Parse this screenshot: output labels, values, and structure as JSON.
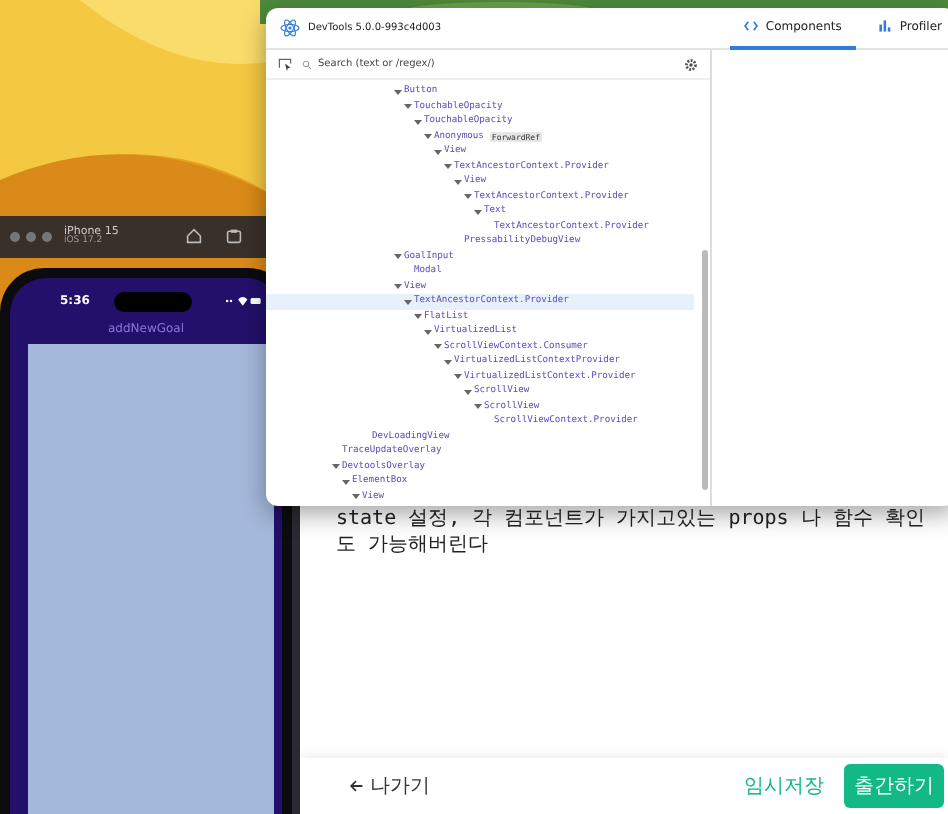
{
  "simulator": {
    "device": "iPhone 15",
    "os": "iOS 17.2",
    "time": "5:36",
    "screen_title": "addNewGoal"
  },
  "devtools": {
    "title": "DevTools 5.0.0-993c4d003",
    "tabs": [
      {
        "label": "Components",
        "selected": true
      },
      {
        "label": "Profiler",
        "selected": false
      }
    ],
    "search": {
      "placeholder": "Search (text or /regex/)"
    },
    "tree": {
      "groups": [
        [
          {
            "name": "Button",
            "expanded": true,
            "selected": false,
            "children": [
              {
                "name": "TouchableOpacity",
                "expanded": true,
                "selected": false,
                "children": [
                  {
                    "name": "TouchableOpacity",
                    "expanded": true,
                    "selected": false,
                    "children": [
                      {
                        "name": "Anonymous",
                        "badge": "ForwardRef",
                        "expanded": true,
                        "selected": false,
                        "children": [
                          {
                            "name": "View",
                            "expanded": true,
                            "selected": false,
                            "children": [
                              {
                                "name": "TextAncestorContext.Provider",
                                "expanded": true,
                                "selected": false,
                                "children": [
                                  {
                                    "name": "View",
                                    "expanded": true,
                                    "selected": false,
                                    "children": [
                                      {
                                        "name": "TextAncestorContext.Provider",
                                        "expanded": true,
                                        "selected": false,
                                        "children": [
                                          {
                                            "name": "Text",
                                            "expanded": true,
                                            "selected": false,
                                            "children": [
                                              {
                                                "name": "TextAncestorContext.Provider",
                                                "selected": false
                                              }
                                            ]
                                          }
                                        ]
                                      }
                                    ]
                                  },
                                  {
                                    "name": "PressabilityDebugView",
                                    "selected": false
                                  }
                                ]
                              }
                            ]
                          }
                        ]
                      }
                    ]
                  }
                ]
              }
            ]
          },
          {
            "name": "GoalInput",
            "expanded": true,
            "selected": false,
            "children": [
              {
                "name": "Modal",
                "selected": false
              }
            ]
          },
          {
            "name": "View",
            "expanded": true,
            "selected": false,
            "children": [
              {
                "name": "TextAncestorContext.Provider",
                "expanded": true,
                "selected": true,
                "children": [
                  {
                    "name": "FlatList",
                    "expanded": true,
                    "selected": false,
                    "children": [
                      {
                        "name": "VirtualizedList",
                        "expanded": true,
                        "selected": false,
                        "children": [
                          {
                            "name": "ScrollViewContext.Consumer",
                            "expanded": true,
                            "selected": false,
                            "children": [
                              {
                                "name": "VirtualizedListContextProvider",
                                "expanded": true,
                                "selected": false,
                                "children": [
                                  {
                                    "name": "VirtualizedListContext.Provider",
                                    "expanded": true,
                                    "selected": false,
                                    "children": [
                                      {
                                        "name": "ScrollView",
                                        "expanded": true,
                                        "selected": false,
                                        "children": [
                                          {
                                            "name": "ScrollView",
                                            "expanded": true,
                                            "selected": false,
                                            "children": [
                                              {
                                                "name": "ScrollViewContext.Provider",
                                                "selected": false
                                              }
                                            ]
                                          }
                                        ]
                                      }
                                    ]
                                  }
                                ]
                              }
                            ]
                          }
                        ]
                      }
                    ]
                  }
                ]
              }
            ]
          }
        ],
        [
          {
            "name": "DevLoadingView",
            "selected": false
          }
        ],
        [
          {
            "name": "TraceUpdateOverlay",
            "selected": false
          },
          {
            "name": "DevtoolsOverlay",
            "expanded": true,
            "selected": false,
            "children": [
              {
                "name": "ElementBox",
                "expanded": true,
                "selected": false,
                "children": [
                  {
                    "name": "View",
                    "expanded": true,
                    "selected": false
                  }
                ]
              }
            ]
          }
        ]
      ]
    }
  },
  "editor": {
    "body": "state 설정, 각 컴포넌트가 가지고있는 props 나 함수 확인도 가능해버린다",
    "back_button": "나가기",
    "save_draft_button": "임시저장",
    "publish_button": "출간하기"
  }
}
